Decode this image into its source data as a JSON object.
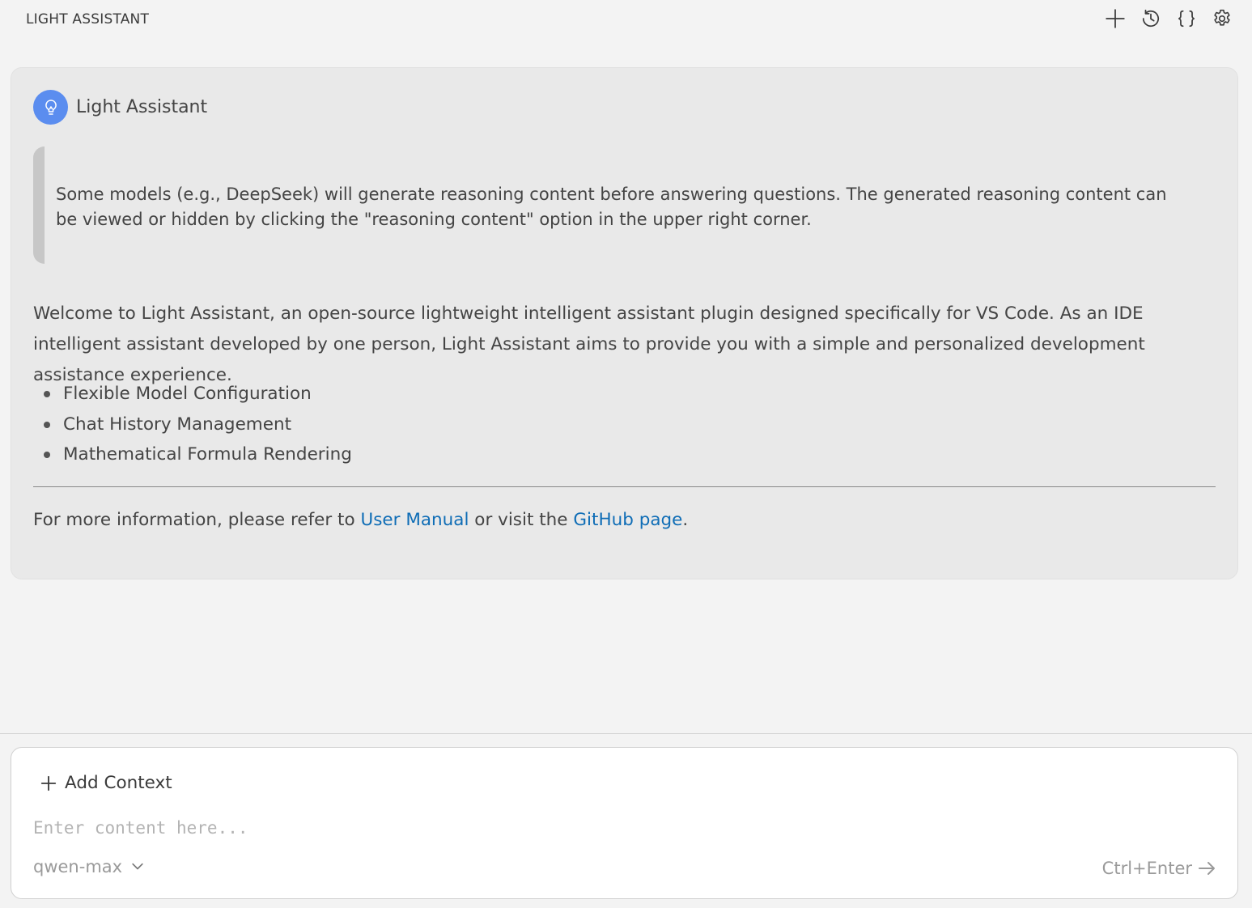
{
  "header": {
    "title": "LIGHT ASSISTANT",
    "actions": [
      {
        "name": "new-chat",
        "icon": "plus-icon"
      },
      {
        "name": "history",
        "icon": "history-icon"
      },
      {
        "name": "context",
        "icon": "braces-icon"
      },
      {
        "name": "settings",
        "icon": "gear-icon"
      }
    ]
  },
  "message": {
    "sender": "Light Assistant",
    "avatar_icon": "lightbulb-icon",
    "avatar_color": "#5b8def",
    "note": "Some models (e.g., DeepSeek) will generate reasoning content before answering questions. The generated reasoning content can be viewed or hidden by clicking the \"reasoning content\" option in the upper right corner.",
    "intro": "Welcome to Light Assistant, an open-source lightweight intelligent assistant plugin designed specifically for VS Code. As an IDE intelligent assistant developed by one person, Light Assistant aims to provide you with a simple and personalized development assistance experience.",
    "features": [
      "Flexible Model Configuration",
      "Chat History Management",
      "Mathematical Formula Rendering"
    ],
    "more_info": {
      "prefix": "For more information, please refer to ",
      "link1": "User Manual",
      "middle": " or visit the ",
      "link2": "GitHub page",
      "suffix": ".",
      "link_color": "#0f6db6"
    }
  },
  "composer": {
    "add_context_label": "Add Context",
    "input_placeholder": "Enter content here...",
    "input_value": "",
    "model": "qwen-max",
    "send_hint": "Ctrl+Enter"
  }
}
